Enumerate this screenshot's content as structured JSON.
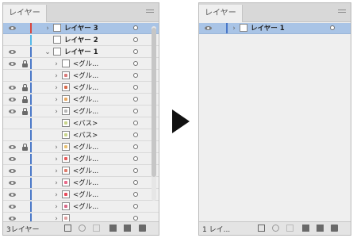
{
  "left_panel": {
    "tab_label": "レイヤー",
    "footer_count": "3レイヤー",
    "rows": [
      {
        "depth": 0,
        "label": "レイヤー 3",
        "eye": true,
        "lock": false,
        "color": "#d9443b",
        "expanded": false,
        "selected": true,
        "bold": true,
        "thumb": "#ffffff"
      },
      {
        "depth": 0,
        "label": "レイヤー 2",
        "eye": false,
        "lock": false,
        "color": "#55b8e8",
        "expanded": null,
        "selected": false,
        "bold": true,
        "thumb": "#ffffff"
      },
      {
        "depth": 0,
        "label": "レイヤー 1",
        "eye": true,
        "lock": false,
        "color": "#4a78c8",
        "expanded": true,
        "selected": false,
        "bold": true,
        "thumb": "#ffffff"
      },
      {
        "depth": 1,
        "label": "<グル...",
        "eye": true,
        "lock": true,
        "color": "#4a78c8",
        "expanded": false,
        "selected": false,
        "bold": false,
        "thumb": "#ffffff"
      },
      {
        "depth": 1,
        "label": "<グル...",
        "eye": false,
        "lock": false,
        "color": "#4a78c8",
        "expanded": false,
        "selected": false,
        "bold": false,
        "thumb": "#d97a7a"
      },
      {
        "depth": 1,
        "label": "<グル...",
        "eye": true,
        "lock": true,
        "color": "#4a78c8",
        "expanded": false,
        "selected": false,
        "bold": false,
        "thumb": "#d96a4a"
      },
      {
        "depth": 1,
        "label": "<グル...",
        "eye": true,
        "lock": true,
        "color": "#4a78c8",
        "expanded": false,
        "selected": false,
        "bold": false,
        "thumb": "#e8a860"
      },
      {
        "depth": 1,
        "label": "<グル...",
        "eye": true,
        "lock": true,
        "color": "#4a78c8",
        "expanded": false,
        "selected": false,
        "bold": false,
        "thumb": "#b8b8b8"
      },
      {
        "depth": 1,
        "label": "<パス>",
        "eye": false,
        "lock": false,
        "color": "#4a78c8",
        "expanded": null,
        "selected": false,
        "bold": false,
        "thumb": "#c8d48a"
      },
      {
        "depth": 1,
        "label": "<パス>",
        "eye": false,
        "lock": false,
        "color": "#4a78c8",
        "expanded": null,
        "selected": false,
        "bold": false,
        "thumb": "#c8d48a"
      },
      {
        "depth": 1,
        "label": "<グル...",
        "eye": true,
        "lock": true,
        "color": "#4a78c8",
        "expanded": false,
        "selected": false,
        "bold": false,
        "thumb": "#e8c070"
      },
      {
        "depth": 1,
        "label": "<グル...",
        "eye": true,
        "lock": false,
        "color": "#4a78c8",
        "expanded": false,
        "selected": false,
        "bold": false,
        "thumb": "#e85a5a"
      },
      {
        "depth": 1,
        "label": "<グル...",
        "eye": true,
        "lock": false,
        "color": "#4a78c8",
        "expanded": false,
        "selected": false,
        "bold": false,
        "thumb": "#e07a6a"
      },
      {
        "depth": 1,
        "label": "<グル...",
        "eye": true,
        "lock": false,
        "color": "#4a78c8",
        "expanded": false,
        "selected": false,
        "bold": false,
        "thumb": "#e86a8a"
      },
      {
        "depth": 1,
        "label": "<グル...",
        "eye": true,
        "lock": false,
        "color": "#4a78c8",
        "expanded": false,
        "selected": false,
        "bold": false,
        "thumb": "#e84a5a"
      },
      {
        "depth": 1,
        "label": "<グル...",
        "eye": true,
        "lock": false,
        "color": "#4a78c8",
        "expanded": false,
        "selected": false,
        "bold": false,
        "thumb": "#d86a8a"
      },
      {
        "depth": 1,
        "label": "",
        "eye": true,
        "lock": false,
        "color": "#4a78c8",
        "expanded": false,
        "selected": false,
        "bold": false,
        "thumb": "#e0a0a0"
      }
    ]
  },
  "right_panel": {
    "tab_label": "レイヤー",
    "footer_count": "1 レイ...",
    "rows": [
      {
        "depth": 0,
        "label": "レイヤー 1",
        "eye": true,
        "lock": false,
        "color": "#4a78c8",
        "expanded": false,
        "selected": true,
        "bold": true,
        "thumb": "#ffffff"
      }
    ]
  },
  "icons": {
    "arrow": "right-arrow-icon",
    "footer": [
      "export-icon",
      "search-icon",
      "clip-icon",
      "new-sublayer-icon",
      "new-layer-icon",
      "delete-icon"
    ]
  }
}
